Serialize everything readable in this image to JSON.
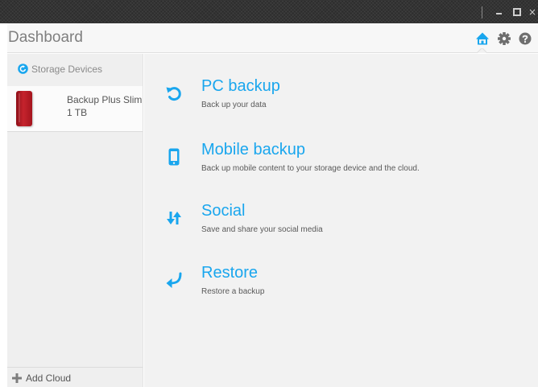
{
  "window": {
    "controls": {
      "minimize_icon": "minimize-icon",
      "maximize_icon": "maximize-icon",
      "close_icon": "close-icon",
      "close_glyph": "×"
    }
  },
  "header": {
    "title": "Dashboard",
    "icons": [
      "home-icon",
      "gear-icon",
      "help-icon"
    ],
    "accent_color": "#19a6ee"
  },
  "sidebar": {
    "heading": "Storage Devices",
    "device": {
      "name": "Backup Plus Slim",
      "capacity": "1 TB",
      "color": "#c0202a"
    },
    "footer": {
      "label": "Add Cloud"
    }
  },
  "main": {
    "actions": [
      {
        "title": "PC backup",
        "description": "Back up your data",
        "icon": "backup-icon"
      },
      {
        "title": "Mobile backup",
        "description": "Back up mobile content to your storage device and the cloud.",
        "icon": "mobile-icon"
      },
      {
        "title": "Social",
        "description": "Save and share your social media",
        "icon": "social-icon"
      },
      {
        "title": "Restore",
        "description": "Restore a backup",
        "icon": "restore-icon"
      }
    ]
  }
}
